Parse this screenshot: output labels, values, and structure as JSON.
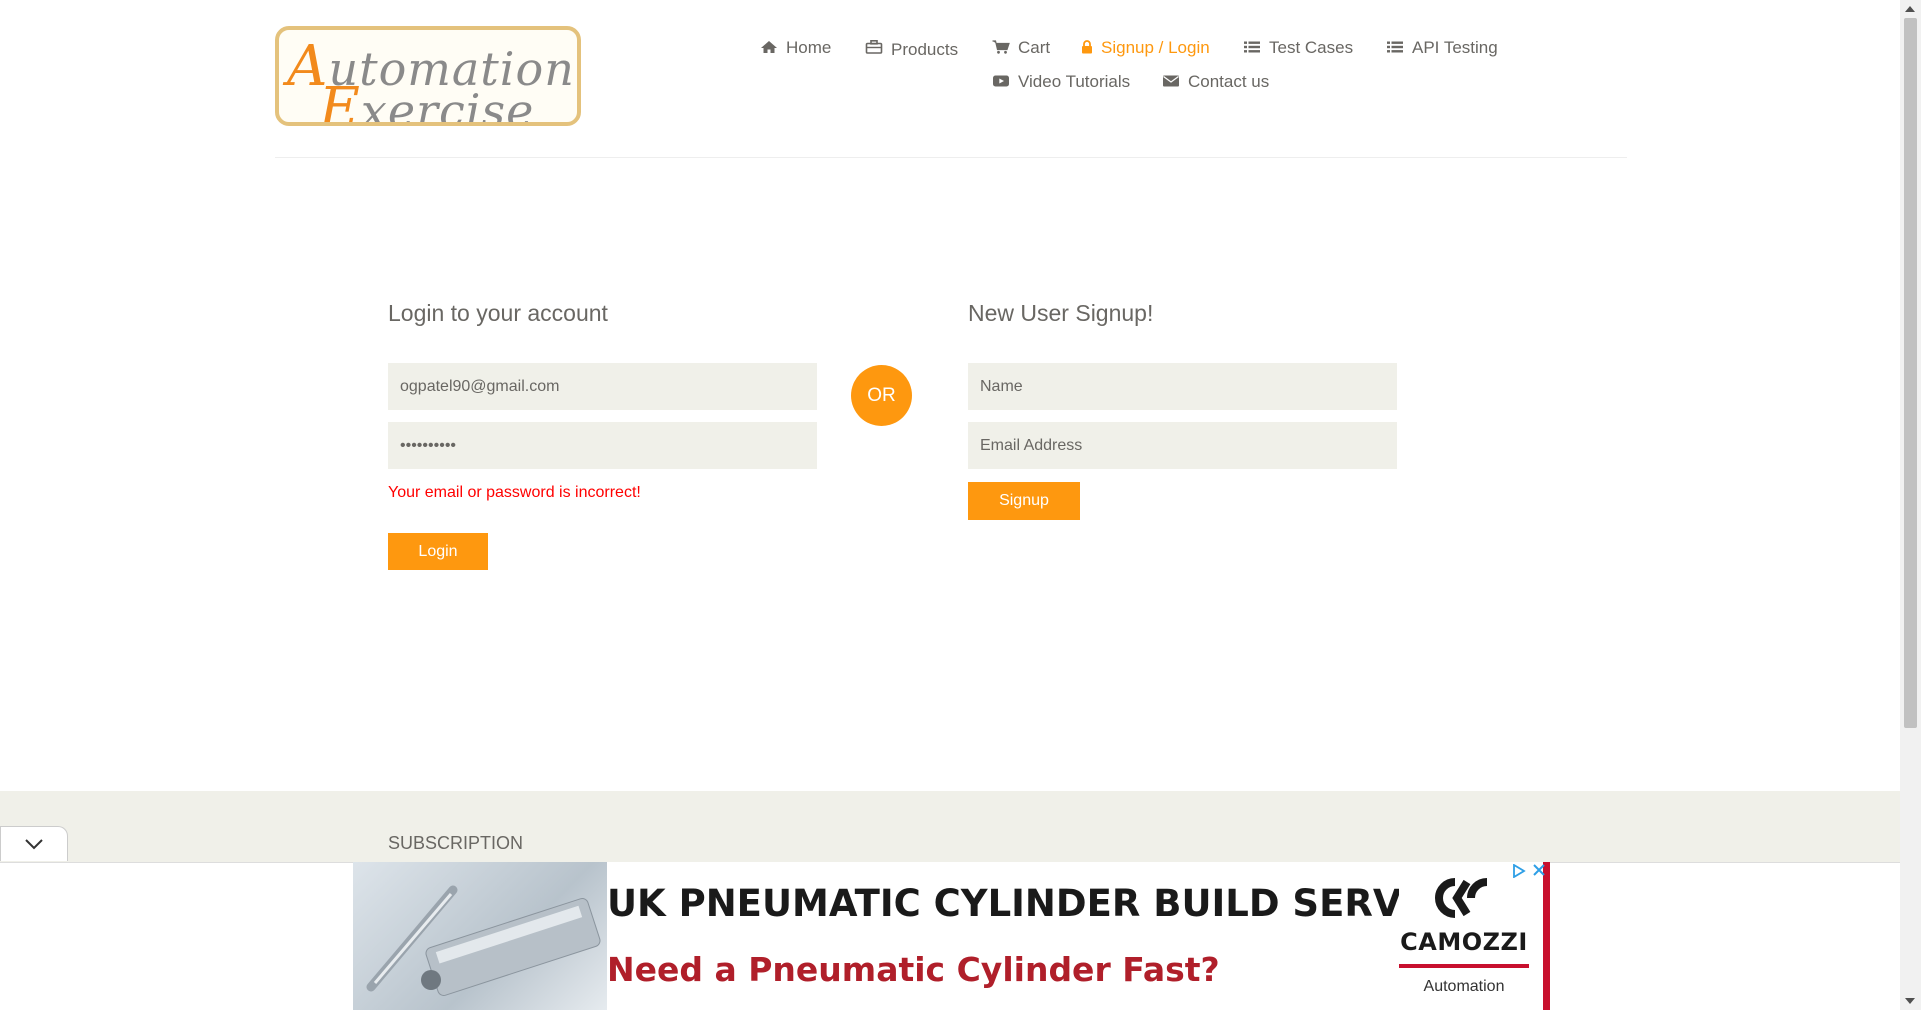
{
  "logo": {
    "line1_cap": "A",
    "line1_rest": "utomation",
    "line2_cap": "E",
    "line2_rest": "xercise"
  },
  "nav": {
    "items": [
      {
        "label": "Home",
        "icon": "home-icon"
      },
      {
        "label": "Products",
        "icon": "briefcase-icon"
      },
      {
        "label": "Cart",
        "icon": "cart-icon"
      },
      {
        "label": "Signup / Login",
        "icon": "lock-icon",
        "active": true
      },
      {
        "label": "Test Cases",
        "icon": "list-icon"
      },
      {
        "label": "API Testing",
        "icon": "list-icon"
      },
      {
        "label": "Video Tutorials",
        "icon": "youtube-play-icon"
      },
      {
        "label": "Contact us",
        "icon": "envelope-icon"
      }
    ]
  },
  "login": {
    "title": "Login to your account",
    "email_value": "ogpatel90@gmail.com",
    "password_value": "••••••••••",
    "error": "Your email or password is incorrect!",
    "button": "Login"
  },
  "or_label": "OR",
  "signup": {
    "title": "New User Signup!",
    "name_placeholder": "Name",
    "email_placeholder": "Email Address",
    "button": "Signup"
  },
  "footer": {
    "subscription": "SUBSCRIPTION"
  },
  "ad": {
    "headline": "UK PNEUMATIC CYLINDER BUILD SERVICE",
    "subline": "Need a Pneumatic Cylinder Fast?",
    "brand": "CAMOZZI",
    "brand_tag": "Automation",
    "choices_icon": "ad-choices-icon",
    "close_icon": "close-icon"
  },
  "colors": {
    "accent": "#fe980f",
    "error": "#ff0000",
    "text": "#696763",
    "input_bg": "#f0f0e9"
  }
}
